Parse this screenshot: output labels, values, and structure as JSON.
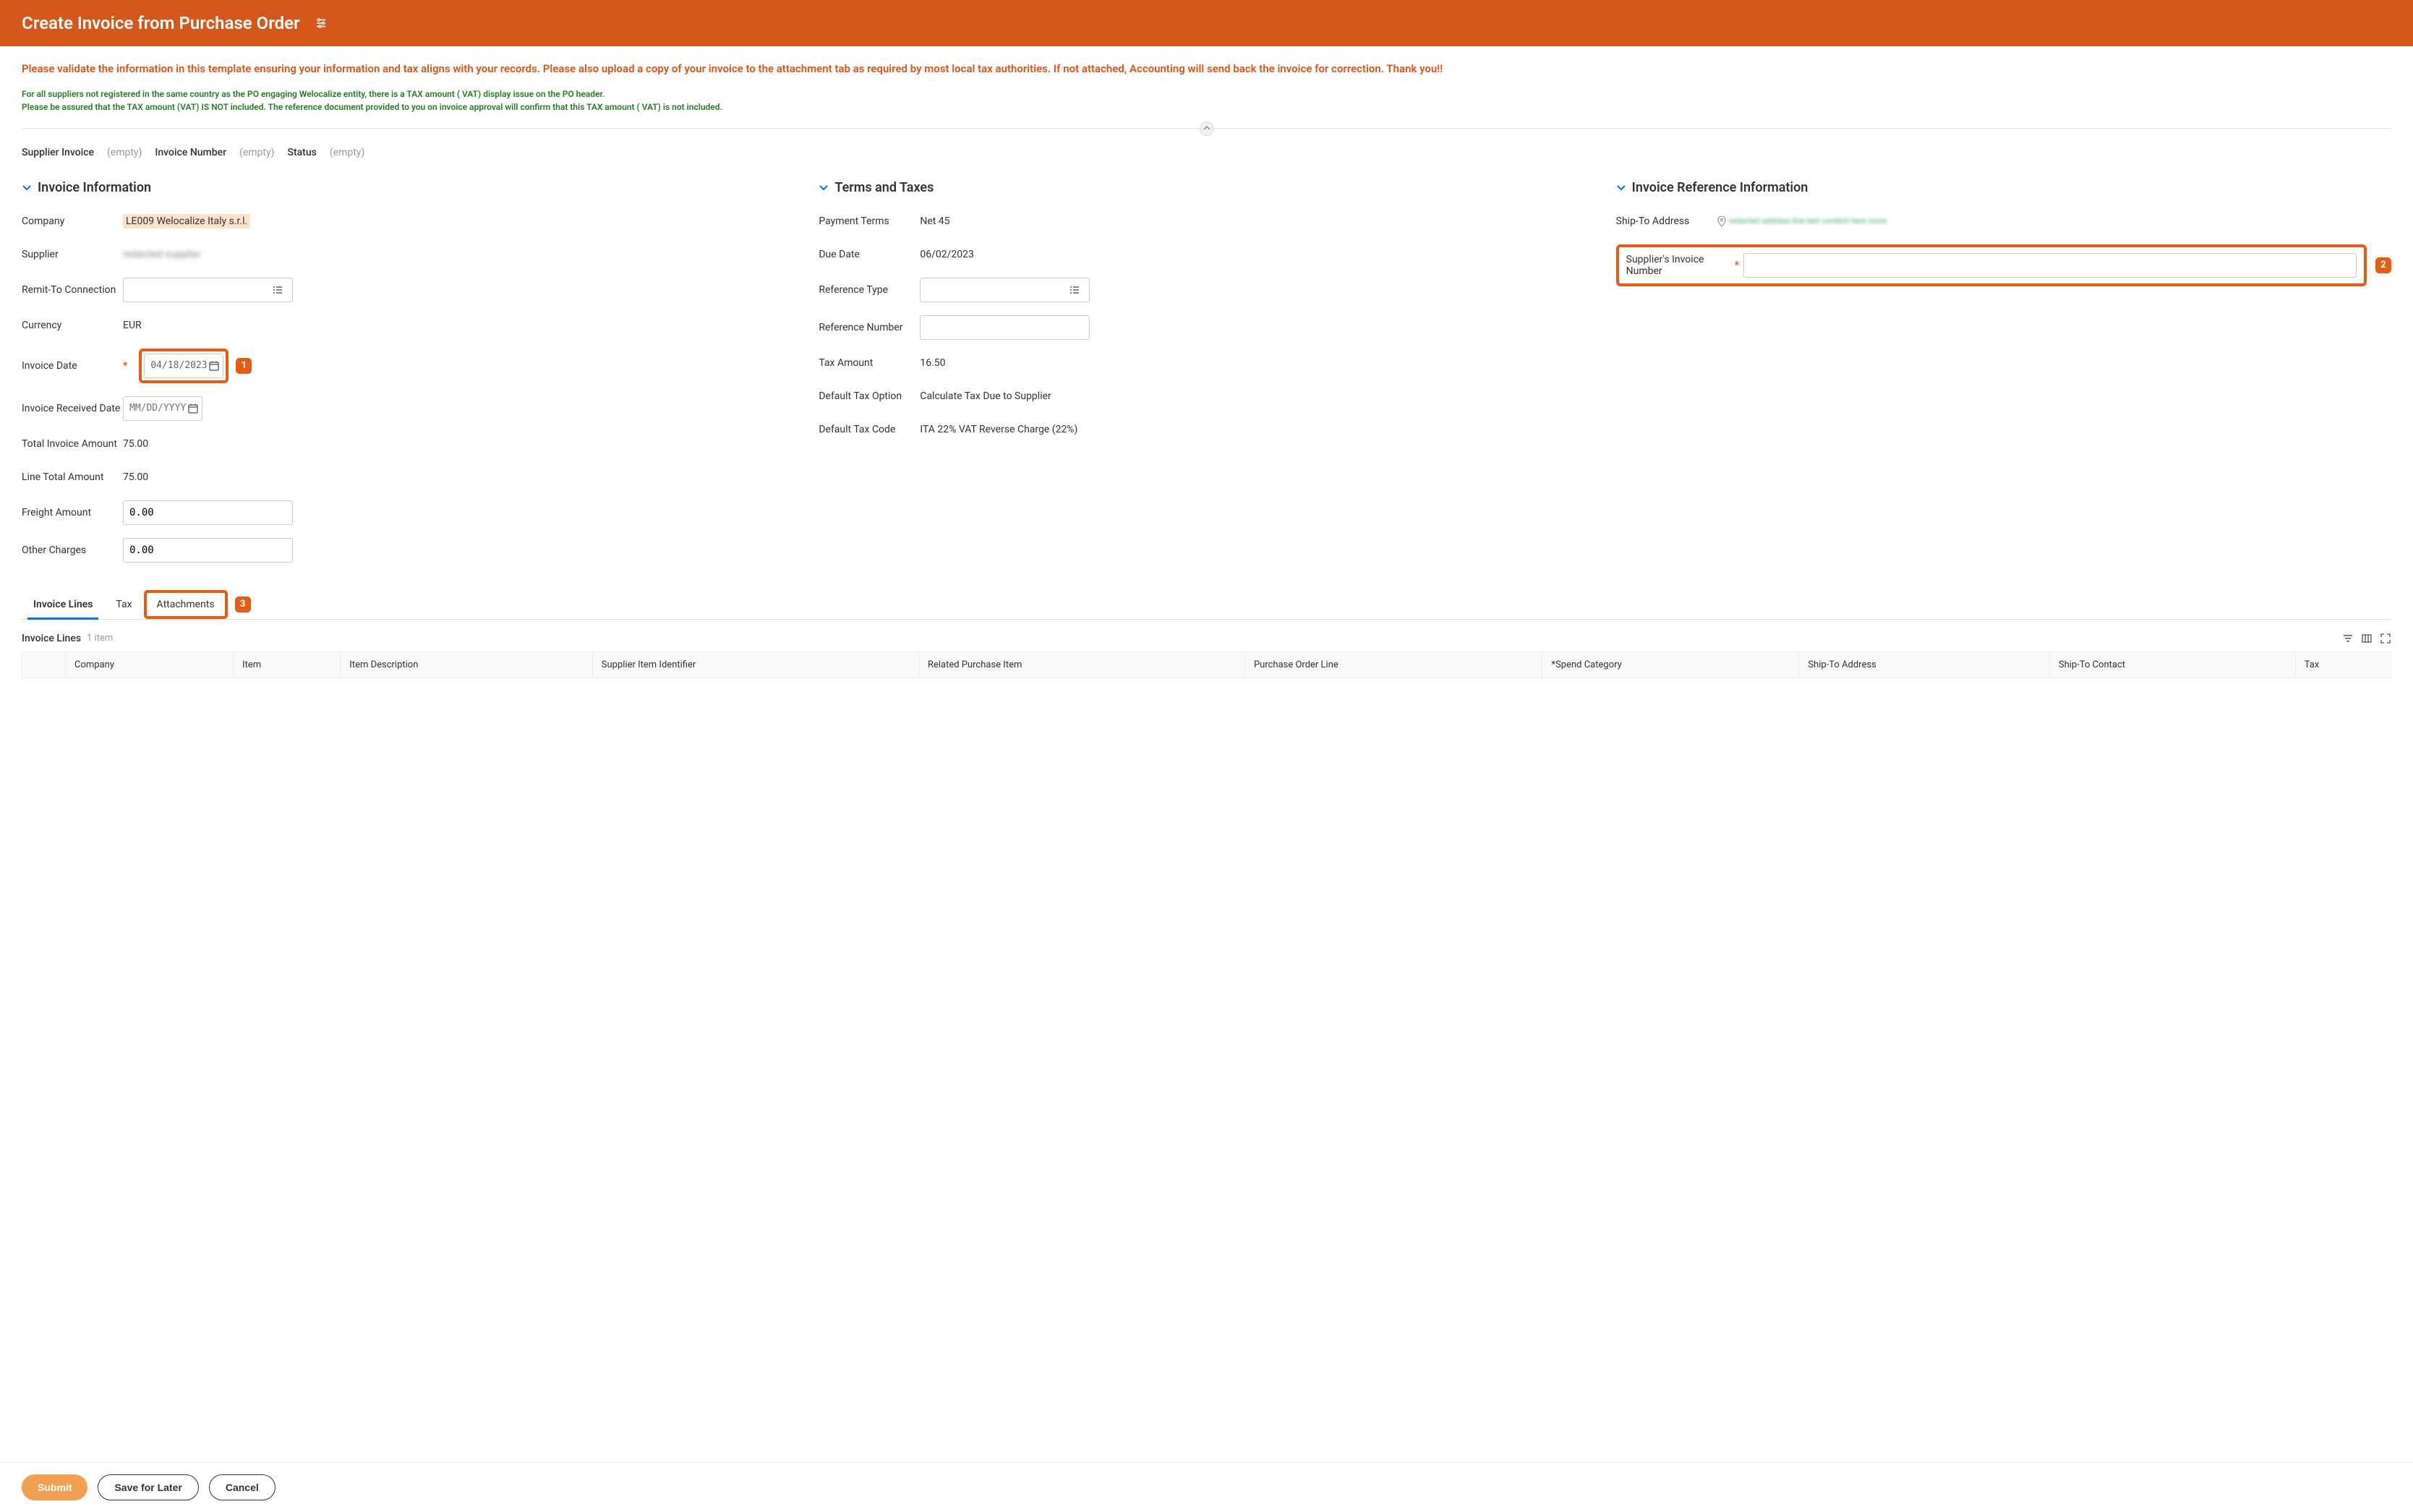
{
  "header": {
    "title": "Create Invoice from Purchase Order"
  },
  "warnings": {
    "red": "Please validate the information in this template ensuring your information and tax aligns with your records. Please also upload a copy of your invoice to the attachment tab as required by most local tax authorities. If not attached, Accounting will send back the invoice for correction. Thank you!!",
    "green1": "For all suppliers not registered in the same country as the PO engaging Welocalize entity, there is a TAX amount  ( VAT) display issue on the PO header.",
    "green2": "Please be assured that the TAX amount (VAT)  IS NOT included. The reference document provided to you on invoice approval will confirm that this TAX amount ( VAT) is not included."
  },
  "status": {
    "supplierInvoiceLabel": "Supplier Invoice",
    "supplierInvoiceValue": "(empty)",
    "invoiceNumberLabel": "Invoice Number",
    "invoiceNumberValue": "(empty)",
    "statusLabel": "Status",
    "statusValue": "(empty)"
  },
  "sections": {
    "invoiceInfo": {
      "title": "Invoice Information",
      "companyLabel": "Company",
      "companyValue": "LE009 Welocalize Italy s.r.l.",
      "supplierLabel": "Supplier",
      "supplierValue": "redacted supplier",
      "remitLabel": "Remit-To Connection",
      "currencyLabel": "Currency",
      "currencyValue": "EUR",
      "invoiceDateLabel": "Invoice Date",
      "invoiceDateValue": "04/18/2023",
      "receivedDateLabel": "Invoice Received Date",
      "receivedDatePlaceholder": "MM/DD/YYYY",
      "totalLabel": "Total Invoice Amount",
      "totalValue": "75.00",
      "lineTotalLabel": "Line Total Amount",
      "lineTotalValue": "75.00",
      "freightLabel": "Freight Amount",
      "freightValue": "0.00",
      "otherLabel": "Other Charges",
      "otherValue": "0.00"
    },
    "terms": {
      "title": "Terms and Taxes",
      "paymentTermsLabel": "Payment Terms",
      "paymentTermsValue": "Net 45",
      "dueDateLabel": "Due Date",
      "dueDateValue": "06/02/2023",
      "refTypeLabel": "Reference Type",
      "refNumLabel": "Reference Number",
      "taxAmountLabel": "Tax Amount",
      "taxAmountValue": "16.50",
      "defTaxOptLabel": "Default Tax Option",
      "defTaxOptValue": "Calculate Tax Due to Supplier",
      "defTaxCodeLabel": "Default Tax Code",
      "defTaxCodeValue": "ITA 22% VAT Reverse Charge (22%)"
    },
    "reference": {
      "title": "Invoice Reference Information",
      "shipToLabel": "Ship-To Address",
      "shipToValue": "redacted address line text content here more",
      "supInvNumLabel": "Supplier's Invoice Number"
    }
  },
  "badges": {
    "one": "1",
    "two": "2",
    "three": "3"
  },
  "tabs": {
    "lines": "Invoice Lines",
    "tax": "Tax",
    "attachments": "Attachments"
  },
  "table": {
    "title": "Invoice Lines",
    "count": "1 item",
    "columns": {
      "company": "Company",
      "item": "Item",
      "itemDesc": "Item Description",
      "supItem": "Supplier Item Identifier",
      "relPurch": "Related Purchase Item",
      "poLine": "Purchase Order Line",
      "spendCat": "*Spend Category",
      "shipAddr": "Ship-To Address",
      "shipContact": "Ship-To Contact",
      "tax": "Tax"
    }
  },
  "footer": {
    "submit": "Submit",
    "saveLater": "Save for Later",
    "cancel": "Cancel"
  }
}
